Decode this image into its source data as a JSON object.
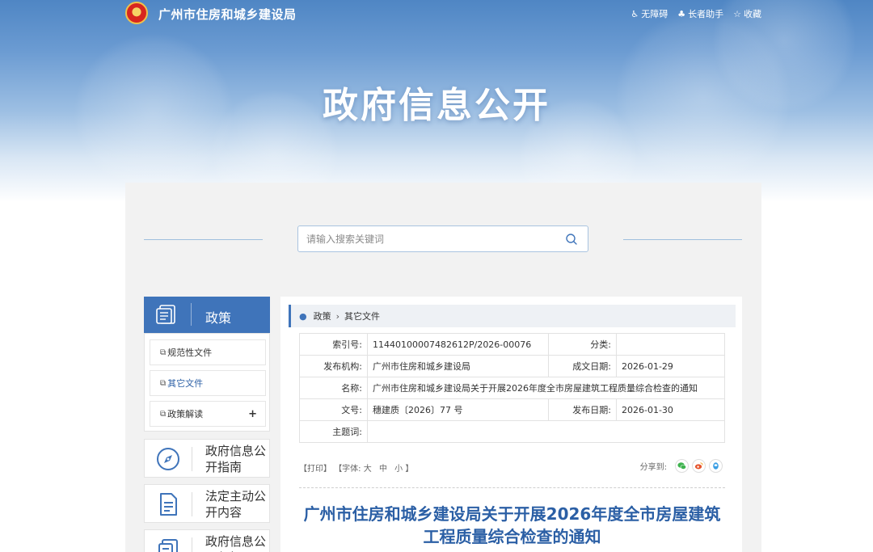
{
  "header": {
    "site_name": "广州市住房和城乡建设局",
    "links": [
      {
        "icon": "accessibility-icon",
        "label": "无障碍"
      },
      {
        "icon": "elder-help-icon",
        "label": "长者助手"
      },
      {
        "icon": "star-icon",
        "label": "收藏"
      }
    ],
    "banner_title": "政府信息公开"
  },
  "search": {
    "placeholder": "请输入搜索关键词",
    "value": ""
  },
  "sidebar": {
    "heading": "政策",
    "items": [
      {
        "label": "规范性文件",
        "icon": "document-icon"
      },
      {
        "label": "其它文件",
        "icon": "document-icon"
      },
      {
        "label": "政策解读",
        "icon": "document-icon",
        "expand": "+"
      }
    ],
    "cards": [
      {
        "label": "政府信息公开指南",
        "icon": "compass-icon"
      },
      {
        "label": "法定主动公开内容",
        "icon": "file-list-icon"
      },
      {
        "label": "政府信息公开年报",
        "icon": "report-icon"
      }
    ]
  },
  "breadcrumb": {
    "items": [
      "政策",
      "其它文件"
    ]
  },
  "info": {
    "index_label": "索引号:",
    "index_value": "11440100007482612P/2026-00076",
    "category_label": "分类:",
    "category_value": "",
    "publisher_label": "发布机构:",
    "publisher_value": "广州市住房和城乡建设局",
    "created_label": "成文日期:",
    "created_value": "2026-01-29",
    "name_label": "名称:",
    "name_value": "广州市住房和城乡建设局关于开展2026年度全市房屋建筑工程质量综合检查的通知",
    "docno_label": "文号:",
    "docno_value": "穗建质〔2026〕77 号",
    "published_label": "发布日期:",
    "published_value": "2026-01-30",
    "keywords_label": "主题词:",
    "keywords_value": ""
  },
  "toolbar": {
    "print": "【打印】",
    "font_open": "【字体:",
    "font_large": "大",
    "font_medium": "中",
    "font_small": "小",
    "font_close": "】",
    "share_label": "分享到:"
  },
  "document": {
    "title": "广州市住房和城乡建设局关于开展2026年度全市房屋建筑工程质量综合检查的通知"
  },
  "colors": {
    "brand_blue": "#3f74ba",
    "title_blue": "#2b5fa5",
    "wechat": "#3fb34f",
    "weibo": "#e6542c",
    "qq": "#3a9ee4"
  }
}
